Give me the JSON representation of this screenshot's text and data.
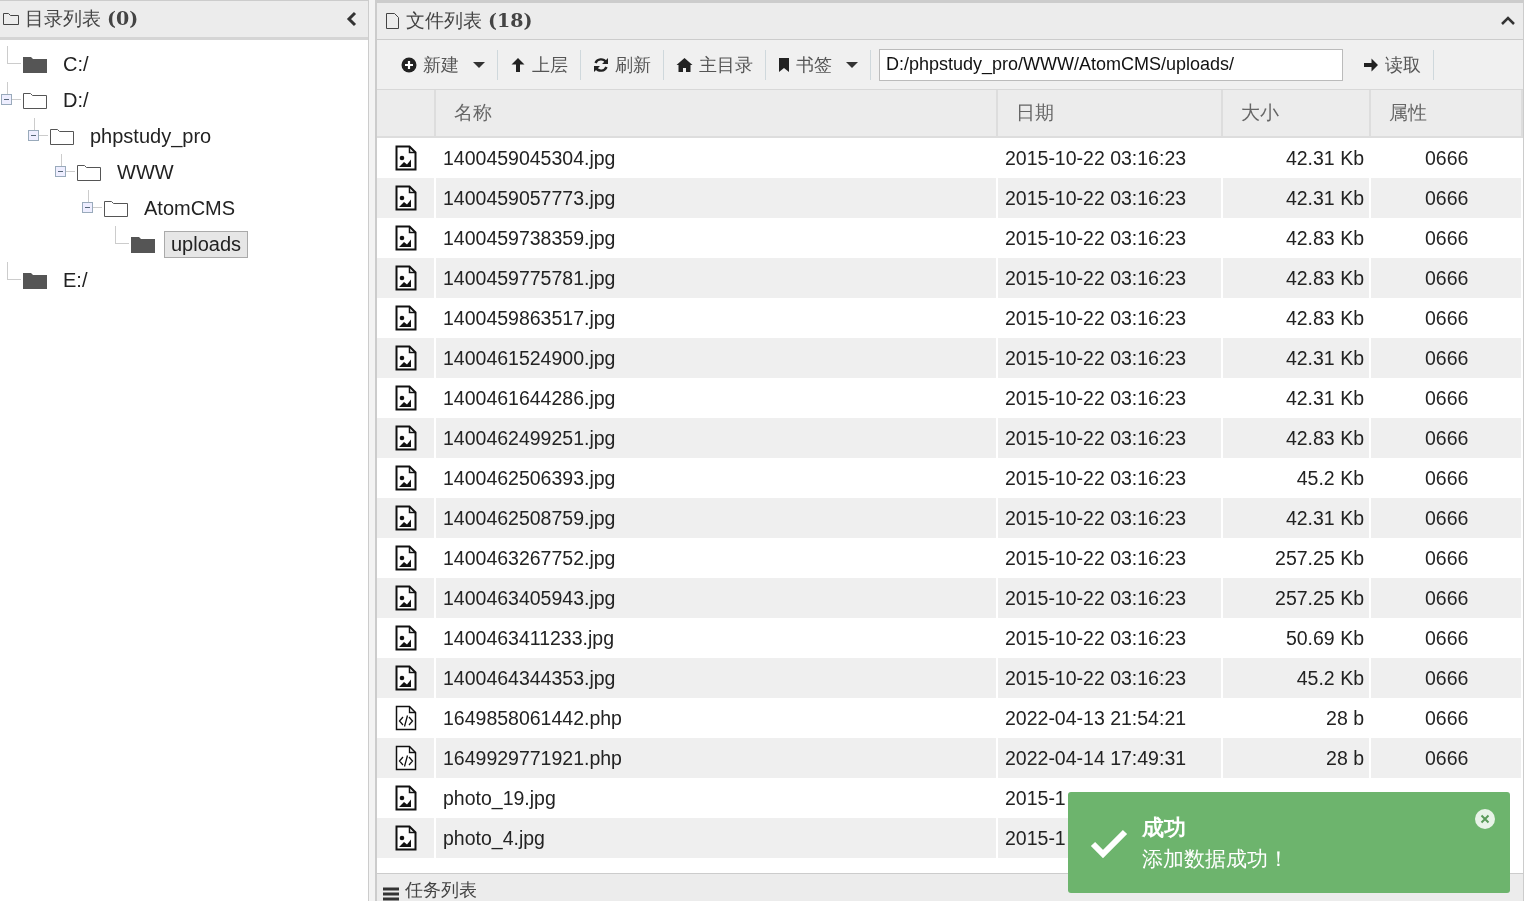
{
  "dir_panel": {
    "title": "目录列表 **(0)**",
    "tree": [
      {
        "label": "C:/",
        "expanded": false,
        "selected": false
      },
      {
        "label": "D:/",
        "expanded": true,
        "selected": false,
        "children": [
          {
            "label": "phpstudy_pro",
            "expanded": true,
            "selected": false,
            "children": [
              {
                "label": "WWW",
                "expanded": true,
                "selected": false,
                "children": [
                  {
                    "label": "AtomCMS",
                    "expanded": true,
                    "selected": false,
                    "children": [
                      {
                        "label": "uploads",
                        "expanded": false,
                        "selected": true
                      }
                    ]
                  }
                ]
              }
            ]
          }
        ]
      },
      {
        "label": "E:/",
        "expanded": false,
        "selected": false
      }
    ]
  },
  "file_panel": {
    "title": "文件列表 **(18)**",
    "toolbar": [
      {
        "kind": "new",
        "label": "新建",
        "dropdown": true
      },
      {
        "kind": "up",
        "label": "上层",
        "dropdown": false
      },
      {
        "kind": "refresh",
        "label": "刷新",
        "dropdown": false
      },
      {
        "kind": "home",
        "label": "主目录",
        "dropdown": false
      },
      {
        "kind": "bookmark",
        "label": "书签",
        "dropdown": true
      }
    ],
    "path": "D:/phpstudy_pro/WWW/AtomCMS/uploads/",
    "read_button": "读取",
    "columns": [
      "名称",
      "日期",
      "大小",
      "属性"
    ],
    "rows": [
      {
        "kind": "image",
        "name": "1400459045304.jpg",
        "date": "2015-10-22 03:16:23",
        "size": "42.31 Kb",
        "attr": "0666"
      },
      {
        "kind": "image",
        "name": "1400459057773.jpg",
        "date": "2015-10-22 03:16:23",
        "size": "42.31 Kb",
        "attr": "0666"
      },
      {
        "kind": "image",
        "name": "1400459738359.jpg",
        "date": "2015-10-22 03:16:23",
        "size": "42.83 Kb",
        "attr": "0666"
      },
      {
        "kind": "image",
        "name": "1400459775781.jpg",
        "date": "2015-10-22 03:16:23",
        "size": "42.83 Kb",
        "attr": "0666"
      },
      {
        "kind": "image",
        "name": "1400459863517.jpg",
        "date": "2015-10-22 03:16:23",
        "size": "42.83 Kb",
        "attr": "0666"
      },
      {
        "kind": "image",
        "name": "1400461524900.jpg",
        "date": "2015-10-22 03:16:23",
        "size": "42.31 Kb",
        "attr": "0666"
      },
      {
        "kind": "image",
        "name": "1400461644286.jpg",
        "date": "2015-10-22 03:16:23",
        "size": "42.31 Kb",
        "attr": "0666"
      },
      {
        "kind": "image",
        "name": "1400462499251.jpg",
        "date": "2015-10-22 03:16:23",
        "size": "42.83 Kb",
        "attr": "0666"
      },
      {
        "kind": "image",
        "name": "1400462506393.jpg",
        "date": "2015-10-22 03:16:23",
        "size": "45.2 Kb",
        "attr": "0666"
      },
      {
        "kind": "image",
        "name": "1400462508759.jpg",
        "date": "2015-10-22 03:16:23",
        "size": "42.31 Kb",
        "attr": "0666"
      },
      {
        "kind": "image",
        "name": "1400463267752.jpg",
        "date": "2015-10-22 03:16:23",
        "size": "257.25 Kb",
        "attr": "0666"
      },
      {
        "kind": "image",
        "name": "1400463405943.jpg",
        "date": "2015-10-22 03:16:23",
        "size": "257.25 Kb",
        "attr": "0666"
      },
      {
        "kind": "image",
        "name": "1400463411233.jpg",
        "date": "2015-10-22 03:16:23",
        "size": "50.69 Kb",
        "attr": "0666"
      },
      {
        "kind": "image",
        "name": "1400464344353.jpg",
        "date": "2015-10-22 03:16:23",
        "size": "45.2 Kb",
        "attr": "0666"
      },
      {
        "kind": "code",
        "name": "1649858061442.php",
        "date": "2022-04-13 21:54:21",
        "size": "28 b",
        "attr": "0666"
      },
      {
        "kind": "code",
        "name": "1649929771921.php",
        "date": "2022-04-14 17:49:31",
        "size": "28 b",
        "attr": "0666"
      },
      {
        "kind": "image",
        "name": "photo_19.jpg",
        "date": "2015-1"
      },
      {
        "kind": "image",
        "name": "photo_4.jpg",
        "date": "2015-1"
      }
    ]
  },
  "task_panel": {
    "title": "任务列表"
  },
  "toast": {
    "title": "成功",
    "message": "添加数据成功！"
  }
}
